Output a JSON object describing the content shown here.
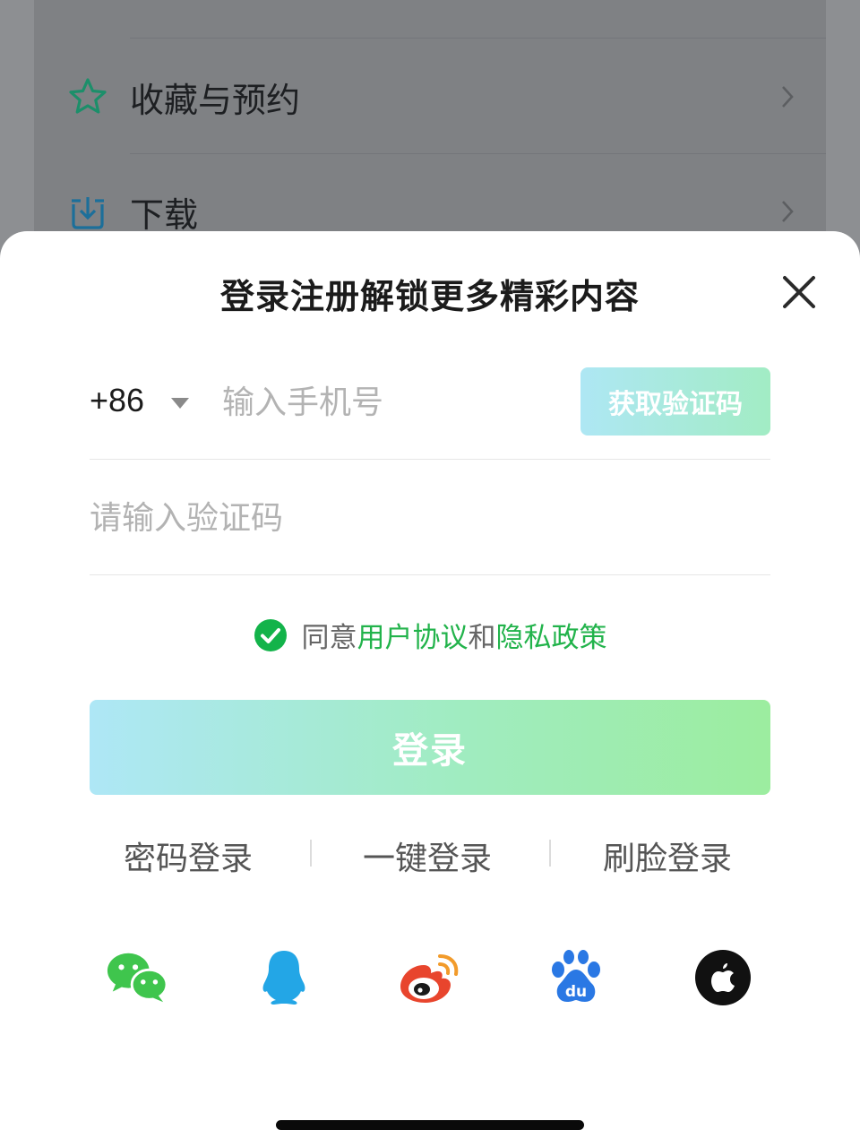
{
  "background": {
    "rows": [
      {
        "label": "收藏与预约",
        "icon": "star-outline-icon"
      },
      {
        "label": "下载",
        "icon": "download-tray-icon"
      }
    ]
  },
  "sheet": {
    "title": "登录注册解锁更多精彩内容",
    "country_code": "+86",
    "phone_placeholder": "输入手机号",
    "get_code_label": "获取验证码",
    "code_placeholder": "请输入验证码",
    "agreement": {
      "prefix": "同意",
      "user_agreement": "用户协议",
      "and": "和",
      "privacy_policy": "隐私政策",
      "checked": true
    },
    "login_label": "登录",
    "alt_logins": [
      "密码登录",
      "一键登录",
      "刷脸登录"
    ],
    "social": [
      "wechat-icon",
      "qq-icon",
      "weibo-icon",
      "baidu-icon",
      "apple-icon"
    ]
  },
  "colors": {
    "accent_green": "#22b34b",
    "gradient_start": "#aee7f6",
    "gradient_end": "#9ced9f"
  }
}
